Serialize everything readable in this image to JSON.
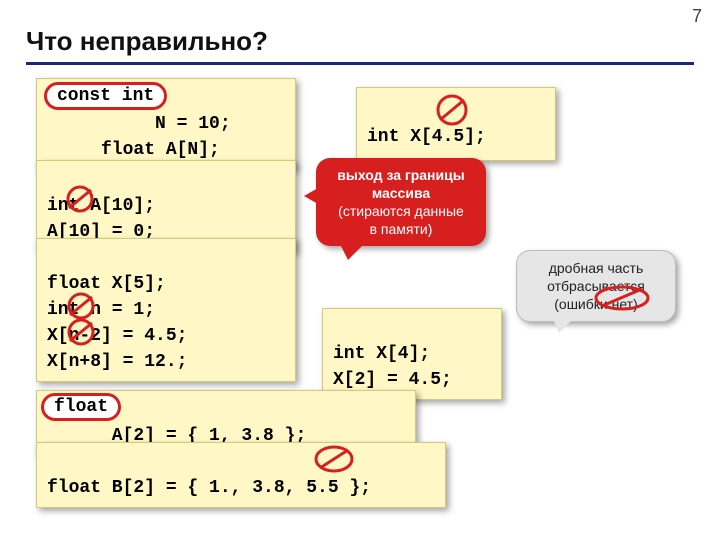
{
  "pagenum": "7",
  "title": "Что неправильно?",
  "box1_line1": "          N = 10;",
  "box1_line2": "     float A[N];",
  "pill1": "const int",
  "box2": "int X[4.5];",
  "box3_line1": "int A[10];",
  "box3_line2": "A[10] = 0;",
  "box4_line1": "float X[5];",
  "box4_line2": "int n = 1;",
  "box4_line3": "X[n-2] = 4.5;",
  "box4_line4": "X[n+8] = 12.;",
  "box5_line1": "int X[4];",
  "box5_line2": "X[2] = 4.5;",
  "box6": "      A[2] = { 1, 3.8 };",
  "pill2": "float",
  "box7": "float B[2] = { 1., 3.8, 5.5 };",
  "red_callout_line1": "выход за границы",
  "red_callout_line2": "массива",
  "red_callout_line3": "(стираются данные",
  "red_callout_line4": "в памяти)",
  "grey_callout_line1": "дробная часть",
  "grey_callout_line2": "отбрасывается",
  "grey_callout_line3": "(ошибки нет)"
}
